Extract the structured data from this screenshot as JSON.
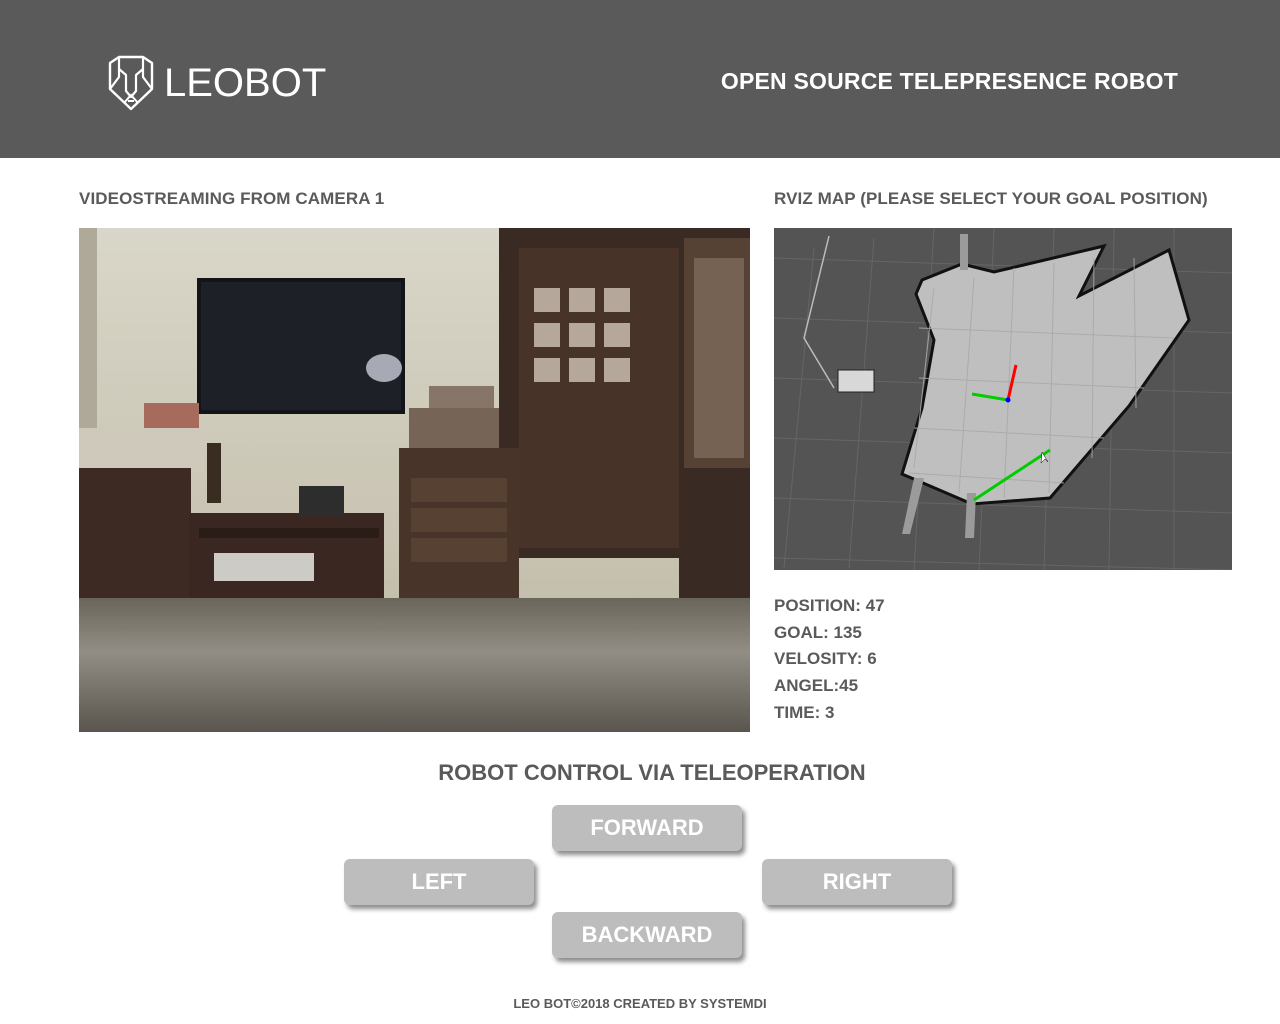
{
  "header": {
    "logo_text": "LEOBOT",
    "tagline": "OPEN SOURCE TELEPRESENCE ROBOT"
  },
  "video": {
    "title": "VIDEOSTREAMING FROM CAMERA 1"
  },
  "map": {
    "title": "RVIZ MAP (PLEASE SELECT YOUR GOAL POSITION)"
  },
  "stats": [
    {
      "label": "POSITION: 47"
    },
    {
      "label": "GOAL: 135"
    },
    {
      "label": "VELOSITY: 6"
    },
    {
      "label": "ANGEL:45"
    },
    {
      "label": "TIME: 3"
    }
  ],
  "control": {
    "title": "ROBOT CONTROL VIA TELEOPERATION",
    "forward": "FORWARD",
    "left": "LEFT",
    "right": "RIGHT",
    "backward": "BACKWARD"
  },
  "footer": {
    "text": "LEO BOT©2018 CREATED BY SYSTEMDI"
  },
  "colors": {
    "header_bg": "#5a5a5a",
    "text": "#5a5a5a",
    "button_bg": "#bdbdbd",
    "map_bg": "#555555",
    "axis_x": "#ff0000",
    "axis_y": "#00cc00",
    "axis_z": "#0000ff"
  }
}
